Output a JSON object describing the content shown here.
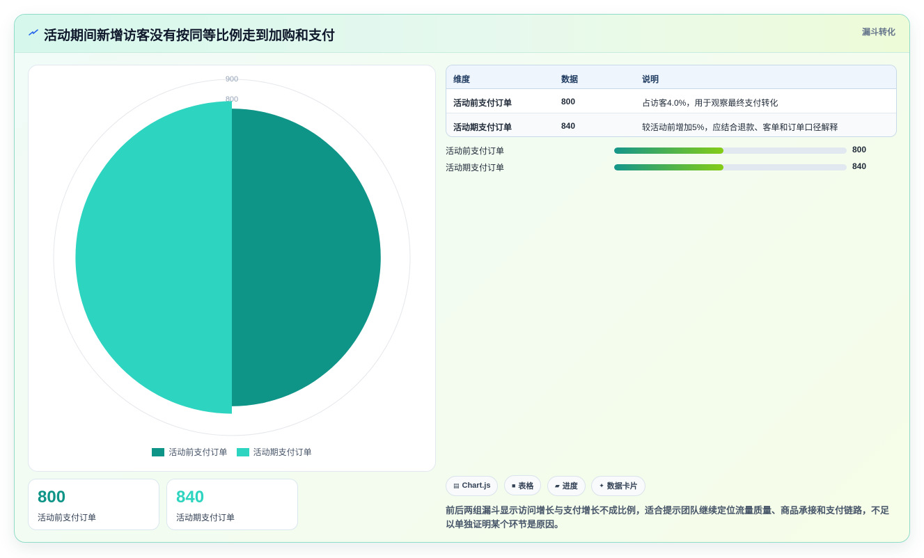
{
  "header": {
    "title": "活动期间新增访客没有按同等比例走到加购和支付",
    "tag": "漏斗转化",
    "icon": "bolt-icon"
  },
  "colors": {
    "series1": "#0f9488",
    "series2": "#2dd4bf",
    "accent": "#15968a",
    "progress_end": "#84cc16"
  },
  "chart_data": {
    "type": "pie",
    "categories": [
      "活动前支付订单",
      "活动期支付订单"
    ],
    "values": [
      800,
      840
    ],
    "radial_ticks": [
      "900",
      "800"
    ],
    "colors": [
      "#0f9488",
      "#2dd4bf"
    ],
    "legend": "bottom"
  },
  "stats": [
    {
      "value": "800",
      "label": "活动前支付订单",
      "color": "#0f9488"
    },
    {
      "value": "840",
      "label": "活动期支付订单",
      "color": "#2dd4bf"
    }
  ],
  "table": {
    "headers": [
      "维度",
      "数据",
      "说明"
    ],
    "rows": [
      [
        "活动前支付订单",
        "800",
        "占访客4.0%，用于观察最终支付转化"
      ],
      [
        "活动期支付订单",
        "840",
        "较活动前增加5%，应结合退款、客单和订单口径解释"
      ]
    ]
  },
  "progress": [
    {
      "label": "活动前支付订单",
      "value": "800",
      "fraction": 0.47
    },
    {
      "label": "活动期支付订单",
      "value": "840",
      "fraction": 0.47
    }
  ],
  "chips": [
    {
      "icon": "chart-icon",
      "glyph": "▤",
      "label": "Chart.js"
    },
    {
      "icon": "table-icon",
      "glyph": "■",
      "label": "表格"
    },
    {
      "icon": "progress-icon",
      "glyph": "▰",
      "label": "进度"
    },
    {
      "icon": "sparkle-icon",
      "glyph": "✦",
      "label": "数据卡片"
    }
  ],
  "summary": "前后两组漏斗显示访问增长与支付增长不成比例，适合提示团队继续定位流量质量、商品承接和支付链路，不足以单独证明某个环节是原因。"
}
